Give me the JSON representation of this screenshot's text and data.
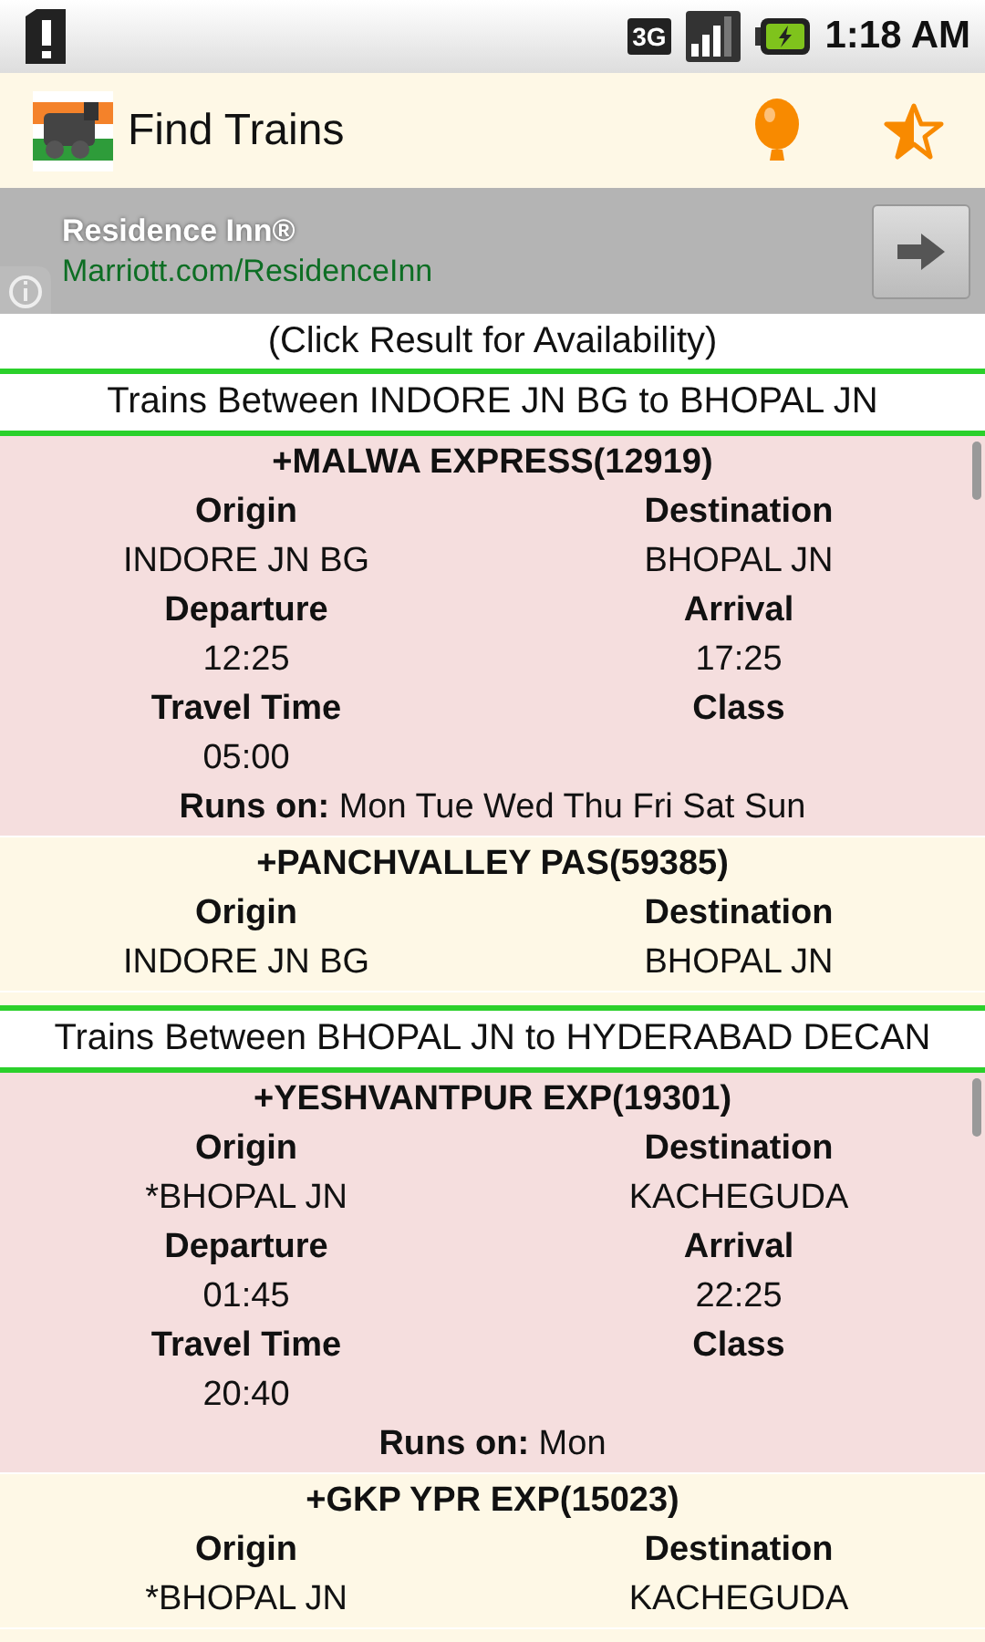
{
  "status_bar": {
    "time": "1:18 AM",
    "network": "3G"
  },
  "header": {
    "title": "Find Trains"
  },
  "ad": {
    "title": "Residence Inn®",
    "url": "Marriott.com/ResidenceInn"
  },
  "hint": "(Click Result for Availability)",
  "sections": [
    {
      "title": "Trains Between INDORE JN BG to BHOPAL JN",
      "trains": [
        {
          "name": "+MALWA EXPRESS(12919)",
          "color": "#f5dede",
          "rows": [
            [
              {
                "label": "Origin",
                "value": "INDORE JN BG"
              },
              {
                "label": "Destination",
                "value": "BHOPAL JN"
              }
            ],
            [
              {
                "label": "Departure",
                "value": "12:25"
              },
              {
                "label": "Arrival",
                "value": "17:25"
              }
            ],
            [
              {
                "label": "Travel Time",
                "value": "05:00"
              },
              {
                "label": "Class"
              }
            ]
          ],
          "runs_on": {
            "label": "Runs on:",
            "value": "Mon Tue Wed Thu Fri Sat Sun"
          }
        },
        {
          "name": "+PANCHVALLEY PAS(59385)",
          "color": "#fef8e6",
          "rows": [
            [
              {
                "label": "Origin",
                "value": "INDORE JN BG"
              },
              {
                "label": "Destination",
                "value": "BHOPAL JN"
              }
            ]
          ]
        }
      ]
    },
    {
      "title": "Trains Between BHOPAL JN to HYDERABAD DECAN",
      "trains": [
        {
          "name": "+YESHVANTPUR EXP(19301)",
          "color": "#f5dede",
          "rows": [
            [
              {
                "label": "Origin",
                "value": "*BHOPAL JN"
              },
              {
                "label": "Destination",
                "value": "KACHEGUDA"
              }
            ],
            [
              {
                "label": "Departure",
                "value": "01:45"
              },
              {
                "label": "Arrival",
                "value": "22:25"
              }
            ],
            [
              {
                "label": "Travel Time",
                "value": "20:40"
              },
              {
                "label": "Class"
              }
            ]
          ],
          "runs_on": {
            "label": "Runs on:",
            "value": "Mon"
          }
        },
        {
          "name": "+GKP YPR EXP(15023)",
          "color": "#fef8e6",
          "rows": [
            [
              {
                "label": "Origin",
                "value": "*BHOPAL JN"
              },
              {
                "label": "Destination",
                "value": "KACHEGUDA"
              }
            ]
          ]
        }
      ]
    }
  ]
}
